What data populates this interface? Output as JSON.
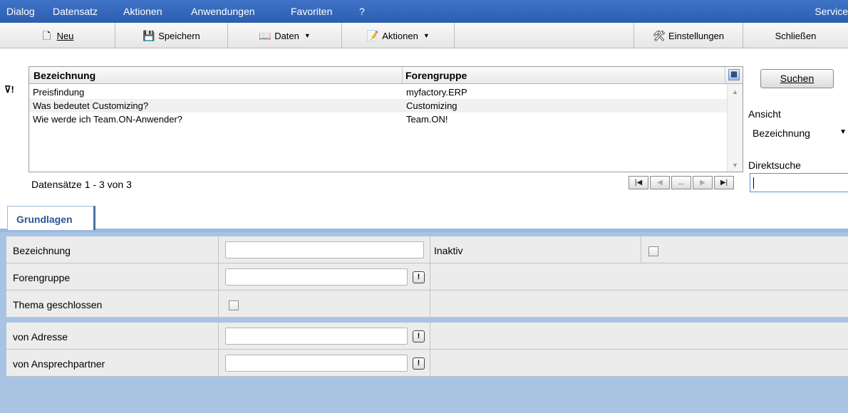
{
  "menu": {
    "items": [
      "Dialog",
      "Datensatz",
      "Aktionen",
      "Anwendungen",
      "Favoriten",
      "?"
    ],
    "right_title": "Service"
  },
  "toolbar": {
    "new_label": "Neu",
    "save_label": "Speichern",
    "data_label": "Daten",
    "actions_label": "Aktionen",
    "settings_label": "Einstellungen",
    "close_label": "Schließen"
  },
  "grid": {
    "columns": [
      "Bezeichnung",
      "Forengruppe"
    ],
    "rows": [
      {
        "bezeichnung": "Preisfindung",
        "forengruppe": "myfactory.ERP"
      },
      {
        "bezeichnung": "Was bedeutet Customizing?",
        "forengruppe": "Customizing"
      },
      {
        "bezeichnung": "Wie werde ich Team.ON-Anwender?",
        "forengruppe": "Team.ON!"
      }
    ],
    "records_label": "Datensätze 1 - 3 von 3",
    "nav": [
      "|◀",
      "◀",
      "...",
      "▶",
      "▶|"
    ]
  },
  "side": {
    "search_label": "Suchen",
    "view_label": "Ansicht",
    "view_value": "Bezeichnung",
    "direct_search_label": "Direktsuche",
    "direct_search_value": ""
  },
  "tabs": {
    "active": "Grundlagen"
  },
  "form": {
    "bezeichnung_label": "Bezeichnung",
    "bezeichnung_value": "",
    "inaktiv_label": "Inaktiv",
    "inaktiv_checked": false,
    "forengruppe_label": "Forengruppe",
    "forengruppe_value": "",
    "thema_label": "Thema geschlossen",
    "thema_checked": false,
    "adresse_label": "von Adresse",
    "adresse_value": "",
    "ansprech_label": "von Ansprechpartner",
    "ansprech_value": "",
    "picker_glyph": "!"
  }
}
